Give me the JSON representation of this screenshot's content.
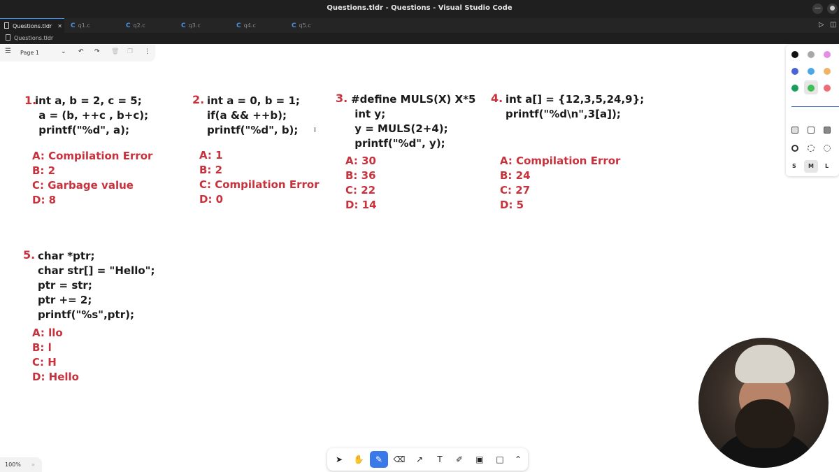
{
  "window": {
    "title": "Questions.tldr - Questions - Visual Studio Code",
    "minimize_glyph": "—",
    "close_glyph": "●"
  },
  "tabs": [
    {
      "label": "Questions.tldr",
      "active": true
    },
    {
      "label": "q1.c",
      "active": false
    },
    {
      "label": "q2.c",
      "active": false
    },
    {
      "label": "q3.c",
      "active": false
    },
    {
      "label": "q4.c",
      "active": false
    },
    {
      "label": "q5.c",
      "active": false
    }
  ],
  "breadcrumb": {
    "file": "Questions.tldr"
  },
  "page_menu": {
    "page_name": "Page 1"
  },
  "style_panel": {
    "colors": [
      "#111111",
      "#a8a8a8",
      "#e38de6",
      "#4a63d8",
      "#4aa8e8",
      "#f0b467",
      "#199e5b",
      "#40c057",
      "#ef6b78"
    ],
    "selected_color": "#40c057",
    "sizes": [
      "S",
      "M",
      "L"
    ],
    "selected_size": "M"
  },
  "questions": [
    {
      "number": "1.",
      "code": "int a, b = 2, c = 5;\n a = (b, ++c , b+c);\n printf(\"%d\", a);",
      "options": "A: Compilation Error\nB: 2\nC: Garbage value\nD: 8"
    },
    {
      "number": "2.",
      "code": "int a = 0, b = 1;\nif(a && ++b);\nprintf(\"%d\", b);",
      "options": "A: 1\nB: 2\nC: Compilation Error\nD: 0"
    },
    {
      "number": "3.",
      "code": "#define MULS(X) X*5\n int y;\n y = MULS(2+4);\n printf(\"%d\", y);",
      "options": "A: 30\nB: 36\nC: 22\nD: 14"
    },
    {
      "number": "4.",
      "code": "int a[] = {12,3,5,24,9};\nprintf(\"%d\\n\",3[a]);",
      "options": "A: Compilation Error\nB: 24\nC: 27\nD: 5"
    },
    {
      "number": "5.",
      "code": "char *ptr;\nchar str[] = \"Hello\";\nptr = str;\nptr += 2;\nprintf(\"%s\",ptr);",
      "options": "A: llo\nB: l\nC: H\nD: Hello"
    }
  ],
  "zoom": {
    "level": "100%"
  },
  "toolbar": {
    "tools": [
      "select",
      "hand",
      "draw",
      "eraser",
      "arrow",
      "text",
      "note",
      "image",
      "rectangle",
      "more"
    ],
    "selected": "draw"
  }
}
